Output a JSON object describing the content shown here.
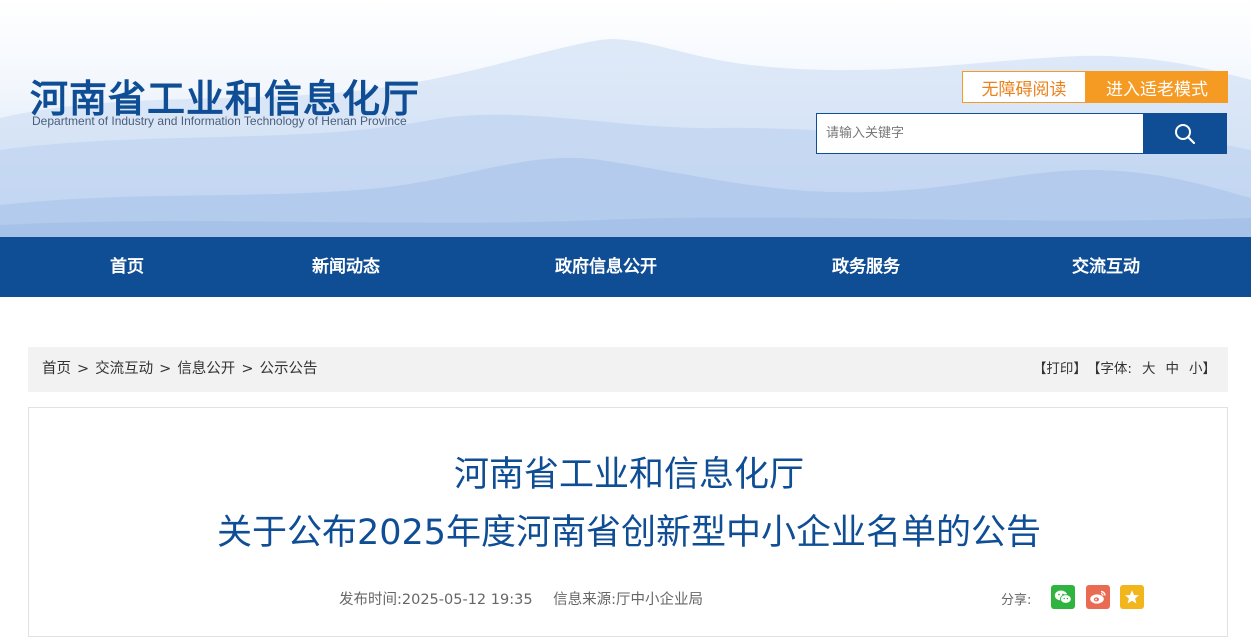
{
  "header": {
    "title": "河南省工业和信息化厅",
    "subtitle": "Department of Industry and Information Technology of Henan Province",
    "accessible_button": "无障碍阅读",
    "elder_mode_button": "进入适老模式",
    "search_placeholder": "请输入关键字",
    "search_icon": "search-icon",
    "colors": {
      "brand": "#0f4d94",
      "accent": "#f59a23"
    }
  },
  "nav": {
    "items": [
      {
        "label": "首页"
      },
      {
        "label": "新闻动态"
      },
      {
        "label": "政府信息公开"
      },
      {
        "label": "政务服务"
      },
      {
        "label": "交流互动"
      }
    ]
  },
  "breadcrumb": {
    "items": [
      "首页",
      "交流互动",
      "信息公开",
      "公示公告"
    ],
    "separator": ">"
  },
  "tools": {
    "print": "【打印】",
    "font_label": "【字体:",
    "font_large": "大",
    "font_medium": "中",
    "font_small": "小",
    "font_close": "】"
  },
  "article": {
    "title_line1": "河南省工业和信息化厅",
    "title_line2": "关于公布2025年度河南省创新型中小企业名单的公告",
    "publish_time": "发布时间:2025-05-12 19:35",
    "source": "信息来源:厅中小企业局",
    "share_label": "分享:",
    "share_icons": [
      "wechat-icon",
      "weibo-icon",
      "star-icon"
    ]
  }
}
